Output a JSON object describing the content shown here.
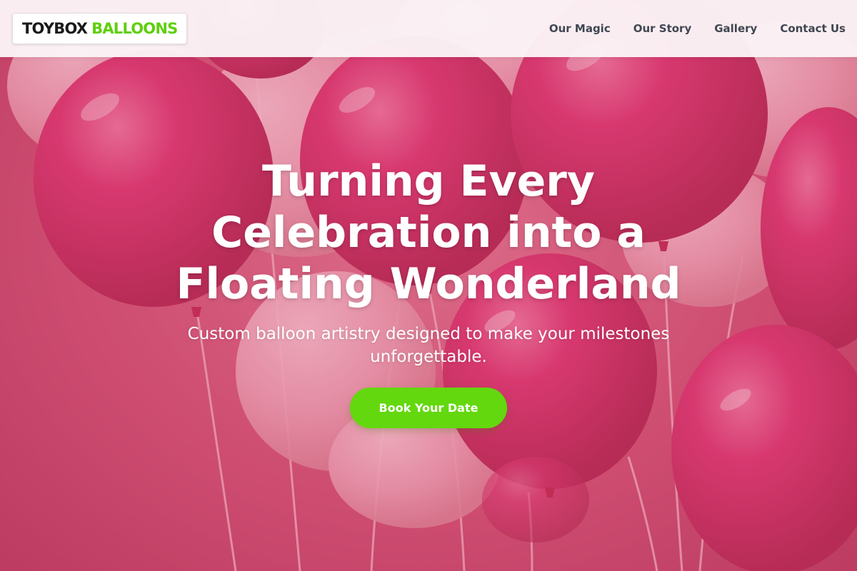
{
  "brand": {
    "name_dark": "TOYBOX",
    "name_accent": "BALLOONS",
    "accent_color": "#5fcf0c"
  },
  "nav": {
    "items": [
      {
        "label": "Our Magic"
      },
      {
        "label": "Our Story"
      },
      {
        "label": "Gallery"
      },
      {
        "label": "Contact Us"
      }
    ]
  },
  "hero": {
    "headline_line1": "Turning Every",
    "headline_line2": "Celebration into a",
    "headline_line3": "Floating Wonderland",
    "subtitle_line1": "Custom balloon artistry designed to make your milestones",
    "subtitle_line2": "unforgettable.",
    "cta_label": "Book Your Date",
    "cta_color": "#63d80e",
    "background_image": "pink-balloons-photo",
    "balloon_color": "#d21556"
  }
}
